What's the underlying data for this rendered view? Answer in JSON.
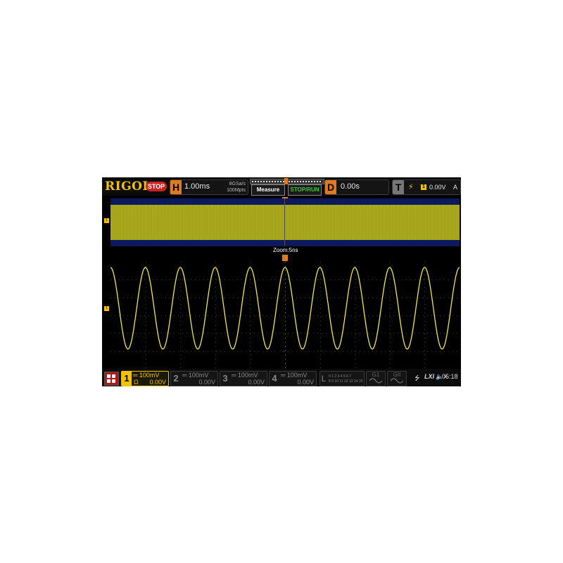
{
  "top_bar": {
    "logo": "RIGOL",
    "run_status": "STOP",
    "horizontal": {
      "letter": "H",
      "timebase": "1.00ms",
      "sample_rate": "8GSa/s",
      "memory_depth": "100Mpts"
    },
    "buttons": {
      "measure": "Measure",
      "stop_run": "STOP/RUN"
    },
    "delay": {
      "letter": "D",
      "value": "0.00s"
    },
    "trigger": {
      "letter": "T",
      "edge": "⚡",
      "source": "1",
      "level": "0.00V",
      "mode": "A"
    }
  },
  "display": {
    "zoom_label": "Zoom:5ns",
    "channel_marker": "1",
    "waveform": {
      "type": "sine",
      "cycles": 10,
      "color": "#f2e84a"
    }
  },
  "bottom_bar": {
    "channels": [
      {
        "number": "1",
        "scale": "═ 100mV",
        "offset": "0.00V",
        "impedance": "Ω",
        "active": true
      },
      {
        "number": "2",
        "scale": "═ 100mV",
        "offset": "0.00V",
        "active": false
      },
      {
        "number": "3",
        "scale": "═ 100mV",
        "offset": "0.00V",
        "active": false
      },
      {
        "number": "4",
        "scale": "═ 100mV",
        "offset": "0.00V",
        "active": false
      }
    ],
    "logic": {
      "letter": "L",
      "row1": "0 1 2 3 4 5 6 7",
      "row2": "8 9 10 11 12 13 14 15"
    },
    "generators": [
      "G1",
      "GII"
    ],
    "status": {
      "usb": "⭍",
      "lxi": "LXI",
      "speaker": "🔈×",
      "time": "05:18"
    }
  },
  "colors": {
    "ch1": "#f2c200",
    "accent": "#e07a20",
    "stop": "#cc2222"
  }
}
